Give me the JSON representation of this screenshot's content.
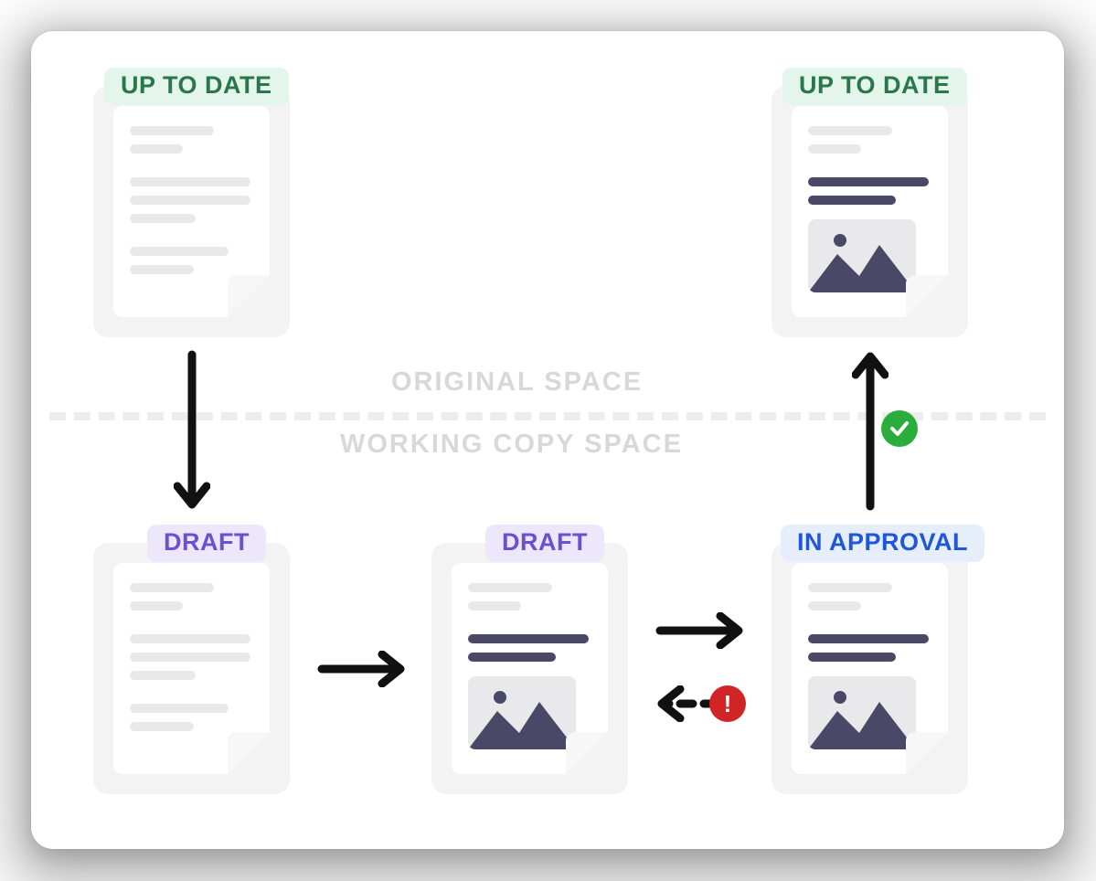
{
  "zones": {
    "top": "ORIGINAL SPACE",
    "bottom": "WORKING COPY SPACE"
  },
  "status_labels": {
    "up_to_date": "UP TO DATE",
    "draft": "DRAFT",
    "in_approval": "IN APPROVAL"
  },
  "nodes": [
    {
      "id": "original-uptodate-start",
      "status": "up_to_date",
      "zone": "top",
      "content": "empty"
    },
    {
      "id": "original-uptodate-end",
      "status": "up_to_date",
      "zone": "top",
      "content": "filled"
    },
    {
      "id": "working-draft-empty",
      "status": "draft",
      "zone": "bottom",
      "content": "empty"
    },
    {
      "id": "working-draft-filled",
      "status": "draft",
      "zone": "bottom",
      "content": "filled"
    },
    {
      "id": "working-in-approval",
      "status": "in_approval",
      "zone": "bottom",
      "content": "filled"
    }
  ],
  "edges": [
    {
      "from": "original-uptodate-start",
      "to": "working-draft-empty",
      "style": "solid",
      "marker": null,
      "direction": "down"
    },
    {
      "from": "working-draft-empty",
      "to": "working-draft-filled",
      "style": "solid",
      "marker": null,
      "direction": "right"
    },
    {
      "from": "working-draft-filled",
      "to": "working-in-approval",
      "style": "solid",
      "marker": null,
      "direction": "right"
    },
    {
      "from": "working-in-approval",
      "to": "working-draft-filled",
      "style": "dashed",
      "marker": "rejected",
      "direction": "left"
    },
    {
      "from": "working-in-approval",
      "to": "original-uptodate-end",
      "style": "solid",
      "marker": "approved",
      "direction": "up"
    }
  ],
  "markers": {
    "approved": "✓",
    "rejected": "!"
  },
  "colors": {
    "badge_green_bg": "#E4F5EB",
    "badge_green_fg": "#29774A",
    "badge_purple_bg": "#ECE7FA",
    "badge_purple_fg": "#6D50D1",
    "badge_blue_bg": "#E6EEFC",
    "badge_blue_fg": "#2057D6",
    "doc_bg": "#F3F3F3",
    "line_light": "#E9E9EB",
    "line_dark": "#494866",
    "approved_marker": "#2BAD3E",
    "rejected_marker": "#D12424"
  }
}
